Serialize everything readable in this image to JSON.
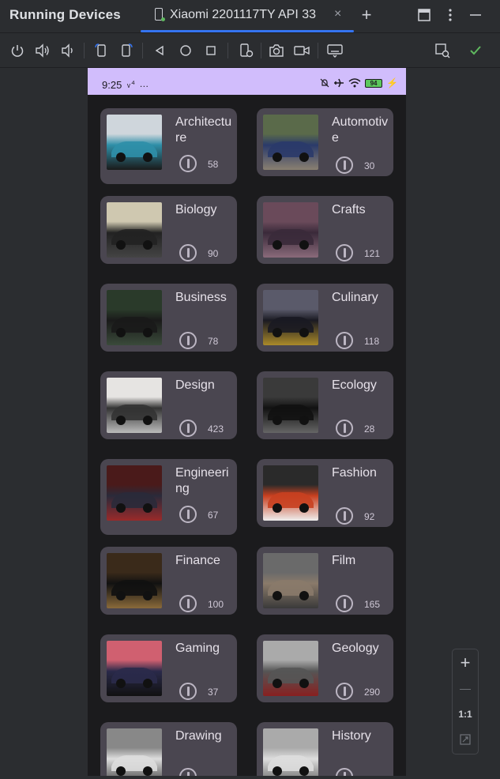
{
  "header": {
    "title": "Running Devices",
    "tab_label": "Xiaomi 2201117TY API 33",
    "tab_close": "×",
    "add_tab": "+",
    "icons": [
      "phone-icon",
      "window-icon",
      "more-vert-icon",
      "minimize-icon"
    ]
  },
  "toolbar": {
    "buttons": [
      "power-icon",
      "volume-up-icon",
      "volume-down-icon",
      "rotate-left-icon",
      "rotate-right-icon",
      "back-icon",
      "home-icon",
      "overview-icon",
      "device-settings-icon",
      "screenshot-icon",
      "screen-record-icon",
      "keyboard-icon",
      "device-frame-icon",
      "check-icon"
    ]
  },
  "status_bar": {
    "time": "9:25",
    "extra": "ᵥ⁴ …",
    "battery": "94"
  },
  "categories": [
    {
      "label": "Architecture",
      "count": "58"
    },
    {
      "label": "Automotive",
      "count": "30"
    },
    {
      "label": "Biology",
      "count": "90"
    },
    {
      "label": "Crafts",
      "count": "121"
    },
    {
      "label": "Business",
      "count": "78"
    },
    {
      "label": "Culinary",
      "count": "118"
    },
    {
      "label": "Design",
      "count": "423"
    },
    {
      "label": "Ecology",
      "count": "28"
    },
    {
      "label": "Engineering",
      "count": "67"
    },
    {
      "label": "Fashion",
      "count": "92"
    },
    {
      "label": "Finance",
      "count": "100"
    },
    {
      "label": "Film",
      "count": "165"
    },
    {
      "label": "Gaming",
      "count": "37"
    },
    {
      "label": "Geology",
      "count": "290"
    },
    {
      "label": "Drawing",
      "count": ""
    },
    {
      "label": "History",
      "count": ""
    }
  ],
  "zoom": {
    "zoom_in": "+",
    "zoom_out": "—",
    "actual_size": "1:1"
  },
  "colors": {
    "status_bar": "#d1bdfc",
    "card": "#4a4650",
    "accent": "#3574f0",
    "check": "#5fb85f"
  }
}
